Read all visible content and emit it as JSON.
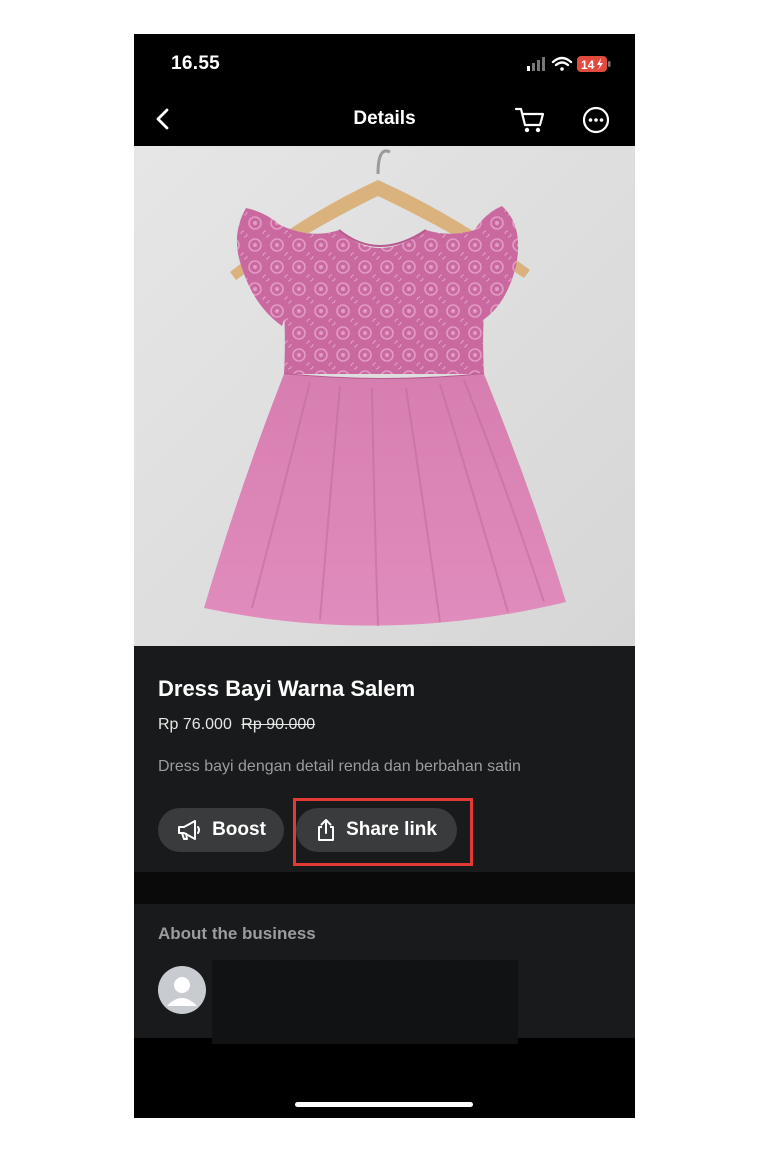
{
  "status_bar": {
    "time": "16.55",
    "battery": "14"
  },
  "nav": {
    "title": "Details"
  },
  "product": {
    "title": "Dress Bayi Warna Salem",
    "price": "Rp 76.000",
    "original_price": "Rp 90.000",
    "description": "Dress bayi dengan detail renda dan berbahan satin"
  },
  "actions": {
    "boost_label": "Boost",
    "share_label": "Share link"
  },
  "about": {
    "title": "About the business"
  },
  "colors": {
    "highlight": "#e53935",
    "panel": "#181a1b",
    "chip": "#3a3b3c"
  },
  "icons": [
    "back-chevron-icon",
    "cart-icon",
    "more-icon",
    "megaphone-icon",
    "share-icon",
    "user-avatar-icon",
    "signal-icon",
    "wifi-icon",
    "battery-icon"
  ]
}
